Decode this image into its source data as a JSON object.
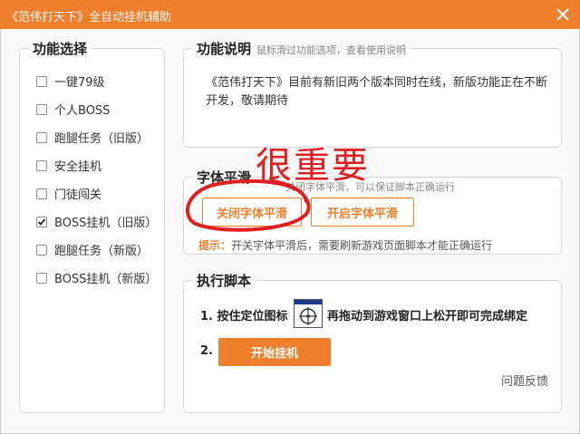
{
  "titlebar": {
    "title": "《范伟打天下》全自动挂机辅助",
    "close_icon": "close-icon"
  },
  "func_panel": {
    "title": "功能选择",
    "items": [
      {
        "label": "一键79级",
        "checked": false
      },
      {
        "label": "个人BOSS",
        "checked": false
      },
      {
        "label": "跑腿任务（旧版）",
        "checked": false
      },
      {
        "label": "安全挂机",
        "checked": false
      },
      {
        "label": "门徒闯关",
        "checked": false
      },
      {
        "label": "BOSS挂机（旧版）",
        "checked": true
      },
      {
        "label": "跑腿任务（新版）",
        "checked": false
      },
      {
        "label": "BOSS挂机（新版）",
        "checked": false
      }
    ]
  },
  "desc_panel": {
    "title": "功能说明",
    "hint": "鼠标滑过功能选项，查看使用说明",
    "text": "《范伟打天下》目前有新旧两个版本同时在线，新版功能正在不断开发，敬请期待"
  },
  "font_panel": {
    "title": "字体平滑",
    "overlap_text": "关闭字体平滑，可以保证脚本正确运行",
    "close_label": "关闭字体平滑",
    "open_label": "开启字体平滑",
    "tip_label": "提示：",
    "tip_text": "开关字体平滑后，需要刷新游戏页面脚本才能正确运行"
  },
  "exec_panel": {
    "title": "执行脚本",
    "step1_prefix": "1. 按住定位图标",
    "step1_suffix": "再拖动到游戏窗口上松开即可完成绑定",
    "step2_prefix": "2.",
    "start_label": "开始挂机",
    "feedback_label": "问题反馈"
  },
  "annotation": {
    "text": "很重要",
    "color": "#e02020"
  },
  "colors": {
    "accent": "#f07f2d"
  }
}
